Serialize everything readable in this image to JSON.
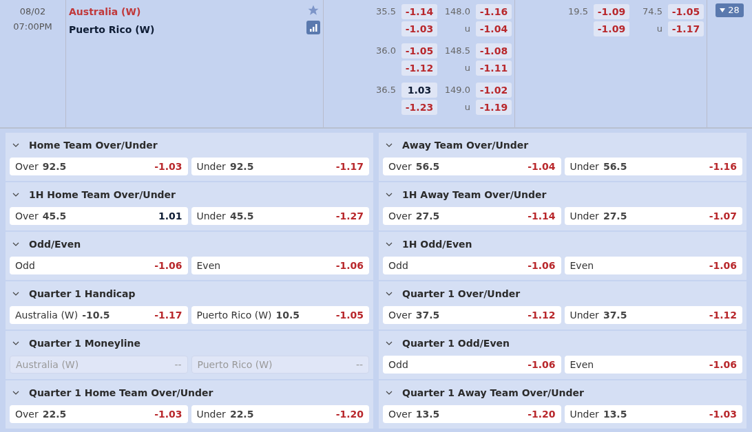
{
  "match": {
    "date": "08/02",
    "time": "07:00PM",
    "favorite_icon": true,
    "teams": [
      {
        "name": "Australia (W)",
        "highlighted": true
      },
      {
        "name": "Puerto Rico (W)",
        "highlighted": false
      }
    ]
  },
  "full_time": {
    "handicap": [
      {
        "line": "35.5",
        "home": {
          "value": "-1.14",
          "negative": true
        },
        "away": {
          "value": "-1.03",
          "negative": true
        }
      },
      {
        "line": "36.0",
        "home": {
          "value": "-1.05",
          "negative": true
        },
        "away": {
          "value": "-1.12",
          "negative": true
        }
      },
      {
        "line": "36.5",
        "home": {
          "value": "1.03",
          "negative": false
        },
        "away": {
          "value": "-1.23",
          "negative": true
        }
      }
    ],
    "total": [
      {
        "line": "148.0",
        "under_label": "u",
        "over": {
          "value": "-1.16",
          "negative": true
        },
        "under": {
          "value": "-1.04",
          "negative": true
        }
      },
      {
        "line": "148.5",
        "under_label": "u",
        "over": {
          "value": "-1.08",
          "negative": true
        },
        "under": {
          "value": "-1.11",
          "negative": true
        }
      },
      {
        "line": "149.0",
        "under_label": "u",
        "over": {
          "value": "-1.02",
          "negative": true
        },
        "under": {
          "value": "-1.19",
          "negative": true
        }
      }
    ]
  },
  "first_half": {
    "handicap": [
      {
        "line": "19.5",
        "home": {
          "value": "-1.09",
          "negative": true
        },
        "away": {
          "value": "-1.09",
          "negative": true
        }
      }
    ],
    "total": [
      {
        "line": "74.5",
        "under_label": "u",
        "over": {
          "value": "-1.05",
          "negative": true
        },
        "under": {
          "value": "-1.17",
          "negative": true
        }
      }
    ]
  },
  "more_button": "28",
  "markets": [
    {
      "title": "Home Team Over/Under",
      "options": [
        {
          "label": "Over",
          "line": "92.5",
          "odds": "-1.03",
          "negative": true,
          "disabled": false
        },
        {
          "label": "Under",
          "line": "92.5",
          "odds": "-1.17",
          "negative": true,
          "disabled": false
        }
      ]
    },
    {
      "title": "Away Team Over/Under",
      "options": [
        {
          "label": "Over",
          "line": "56.5",
          "odds": "-1.04",
          "negative": true,
          "disabled": false
        },
        {
          "label": "Under",
          "line": "56.5",
          "odds": "-1.16",
          "negative": true,
          "disabled": false
        }
      ]
    },
    {
      "title": "1H Home Team Over/Under",
      "options": [
        {
          "label": "Over",
          "line": "45.5",
          "odds": "1.01",
          "negative": false,
          "disabled": false
        },
        {
          "label": "Under",
          "line": "45.5",
          "odds": "-1.27",
          "negative": true,
          "disabled": false
        }
      ]
    },
    {
      "title": "1H Away Team Over/Under",
      "options": [
        {
          "label": "Over",
          "line": "27.5",
          "odds": "-1.14",
          "negative": true,
          "disabled": false
        },
        {
          "label": "Under",
          "line": "27.5",
          "odds": "-1.07",
          "negative": true,
          "disabled": false
        }
      ]
    },
    {
      "title": "Odd/Even",
      "options": [
        {
          "label": "Odd",
          "odds": "-1.06",
          "negative": true,
          "disabled": false
        },
        {
          "label": "Even",
          "odds": "-1.06",
          "negative": true,
          "disabled": false
        }
      ]
    },
    {
      "title": "1H Odd/Even",
      "options": [
        {
          "label": "Odd",
          "odds": "-1.06",
          "negative": true,
          "disabled": false
        },
        {
          "label": "Even",
          "odds": "-1.06",
          "negative": true,
          "disabled": false
        }
      ]
    },
    {
      "title": "Quarter 1 Handicap",
      "options": [
        {
          "label": "Australia (W)",
          "line": "-10.5",
          "odds": "-1.17",
          "negative": true,
          "disabled": false
        },
        {
          "label": "Puerto Rico (W)",
          "line": "10.5",
          "odds": "-1.05",
          "negative": true,
          "disabled": false
        }
      ]
    },
    {
      "title": "Quarter 1 Over/Under",
      "options": [
        {
          "label": "Over",
          "line": "37.5",
          "odds": "-1.12",
          "negative": true,
          "disabled": false
        },
        {
          "label": "Under",
          "line": "37.5",
          "odds": "-1.12",
          "negative": true,
          "disabled": false
        }
      ]
    },
    {
      "title": "Quarter 1 Moneyline",
      "options": [
        {
          "label": "Australia (W)",
          "odds": "--",
          "disabled": true
        },
        {
          "label": "Puerto Rico (W)",
          "odds": "--",
          "disabled": true
        }
      ]
    },
    {
      "title": "Quarter 1 Odd/Even",
      "options": [
        {
          "label": "Odd",
          "odds": "-1.06",
          "negative": true,
          "disabled": false
        },
        {
          "label": "Even",
          "odds": "-1.06",
          "negative": true,
          "disabled": false
        }
      ]
    },
    {
      "title": "Quarter 1 Home Team Over/Under",
      "options": [
        {
          "label": "Over",
          "line": "22.5",
          "odds": "-1.03",
          "negative": true,
          "disabled": false
        },
        {
          "label": "Under",
          "line": "22.5",
          "odds": "-1.20",
          "negative": true,
          "disabled": false
        }
      ]
    },
    {
      "title": "Quarter 1 Away Team Over/Under",
      "options": [
        {
          "label": "Over",
          "line": "13.5",
          "odds": "-1.20",
          "negative": true,
          "disabled": false
        },
        {
          "label": "Under",
          "line": "13.5",
          "odds": "-1.03",
          "negative": true,
          "disabled": false
        }
      ]
    }
  ]
}
